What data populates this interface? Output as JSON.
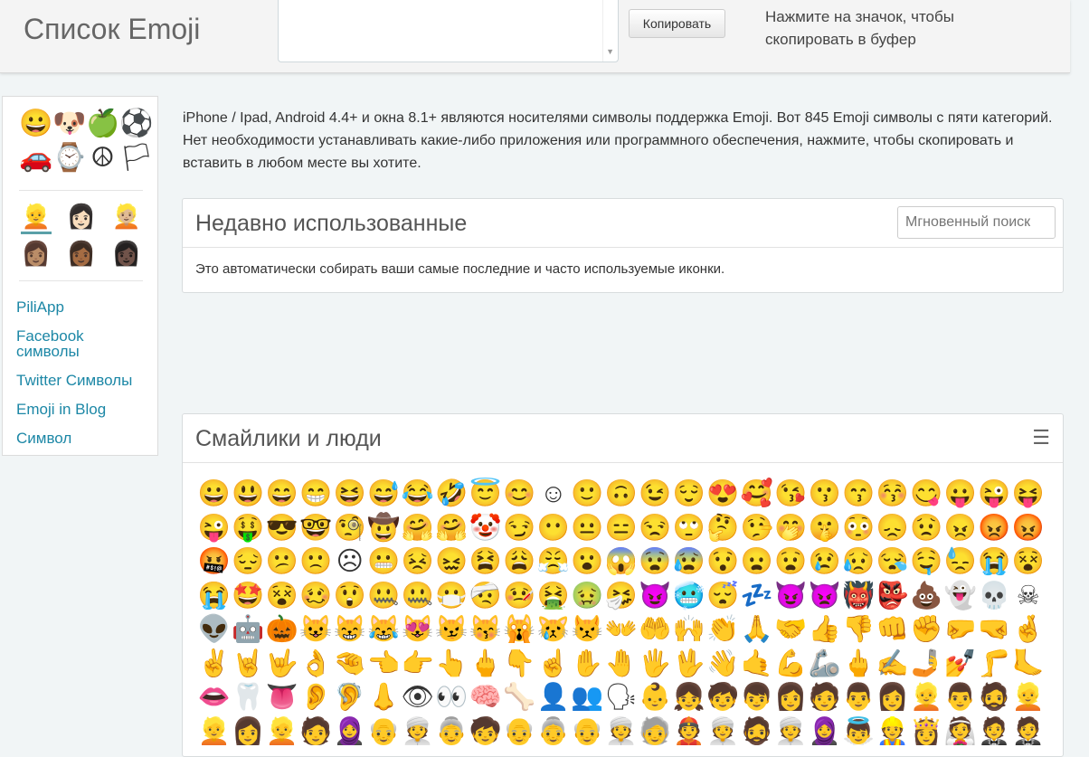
{
  "header": {
    "title": "Список Emoji",
    "copy_button": "Копировать",
    "hint": "Нажмите на значок, чтобы скопировать в буфер"
  },
  "sidebar": {
    "categories": [
      {
        "glyph": "😀",
        "name": "smileys-icon"
      },
      {
        "glyph": "🐶",
        "name": "animals-icon"
      },
      {
        "glyph": "🍏",
        "name": "food-icon"
      },
      {
        "glyph": "⚽",
        "name": "activity-icon"
      },
      {
        "glyph": "🚗",
        "name": "travel-icon"
      },
      {
        "glyph": "⌚",
        "name": "objects-icon"
      },
      {
        "glyph": "☮",
        "name": "symbols-icon"
      },
      {
        "glyph": "🏳",
        "name": "flags-icon"
      }
    ],
    "skin_tones": [
      "👱",
      "👩🏻",
      "👱🏼",
      "👩🏽",
      "👩🏾",
      "👩🏿"
    ],
    "links": [
      "PiliApp",
      "Facebook символы",
      "Twitter Символы",
      "Emoji in Blog",
      "Символ"
    ]
  },
  "intro": "iPhone / Ipad, Android 4.4+ и окна 8.1+ являются носителями символы поддержка Emoji. Вот 845 Emoji символы с пяти категорий. Нет необходимости устанавливать какие-либо приложения или программного обеспечения, нажмите, чтобы скопировать и вставить в любом месте вы хотите.",
  "recent": {
    "title": "Недавно использованные",
    "search_placeholder": "Мгновенный поиск",
    "text": "Это автоматически собирать ваши самые последние и часто используемые иконки."
  },
  "smileys": {
    "title": "Смайлики и люди",
    "emojis": [
      "😀",
      "😃",
      "😄",
      "😁",
      "😆",
      "😅",
      "😂",
      "🤣",
      "😇",
      "😊",
      "☺",
      "🙂",
      "🙃",
      "😉",
      "😌",
      "😍",
      "🥰",
      "😘",
      "😗",
      "😙",
      "😚",
      "😋",
      "😛",
      "😜",
      "😝",
      "😜",
      "🤑",
      "😎",
      "🤓",
      "🧐",
      "🤠",
      "🤗",
      "🤗",
      "🤡",
      "😏",
      "😶",
      "😐",
      "😑",
      "😒",
      "🙄",
      "🤔",
      "🤥",
      "🤭",
      "🤫",
      "😳",
      "😞",
      "😟",
      "😠",
      "😡",
      "😡",
      "🤬",
      "😔",
      "😕",
      "🙁",
      "☹",
      "😬",
      "😣",
      "😖",
      "😫",
      "😩",
      "😤",
      "😮",
      "😱",
      "😨",
      "😰",
      "😯",
      "😦",
      "😧",
      "😢",
      "😥",
      "😪",
      "🤤",
      "😓",
      "😭",
      "😵",
      "😭",
      "🤩",
      "😵",
      "🥴",
      "😲",
      "🤐",
      "🤐",
      "😷",
      "🤕",
      "🤒",
      "🤮",
      "🤢",
      "🤧",
      "😈",
      "🥶",
      "😴",
      "💤",
      "😈",
      "👿",
      "👹",
      "👺",
      "💩",
      "👻",
      "💀",
      "☠",
      "👽",
      "🤖",
      "🎃",
      "😺",
      "😸",
      "😹",
      "😻",
      "😼",
      "😽",
      "🙀",
      "😿",
      "😾",
      "👐",
      "🤲",
      "🙌",
      "👏",
      "🙏",
      "🤝",
      "👍",
      "👎",
      "👊",
      "✊",
      "🤛",
      "🤜",
      "🤞",
      "✌",
      "🤘",
      "🤟",
      "👌",
      "🤏",
      "👈",
      "👉",
      "👆",
      "🖕",
      "👇",
      "☝",
      "✋",
      "🤚",
      "🖐",
      "🖖",
      "👋",
      "🤙",
      "💪",
      "🦾",
      "🖕",
      "✍",
      "🤳",
      "💅",
      "🦵",
      "🦶",
      "👄",
      "🦷",
      "👅",
      "👂",
      "🦻",
      "👃",
      "👁",
      "👀",
      "🧠",
      "🦴",
      "👤",
      "👥",
      "🗣",
      "👶",
      "👧",
      "🧒",
      "👦",
      "👩",
      "🧑",
      "👨",
      "👩",
      "👱",
      "👨",
      "🧔",
      "👱",
      "👱",
      "👩",
      "👱",
      "🧑",
      "🧕",
      "👴",
      "👳",
      "👵",
      "🧒",
      "👴",
      "👵",
      "👴",
      "👳",
      "🧓",
      "👲",
      "👳",
      "🧔",
      "👳",
      "🧕",
      "👼",
      "👷",
      "👸",
      "👰",
      "🤵",
      "🤵"
    ]
  }
}
